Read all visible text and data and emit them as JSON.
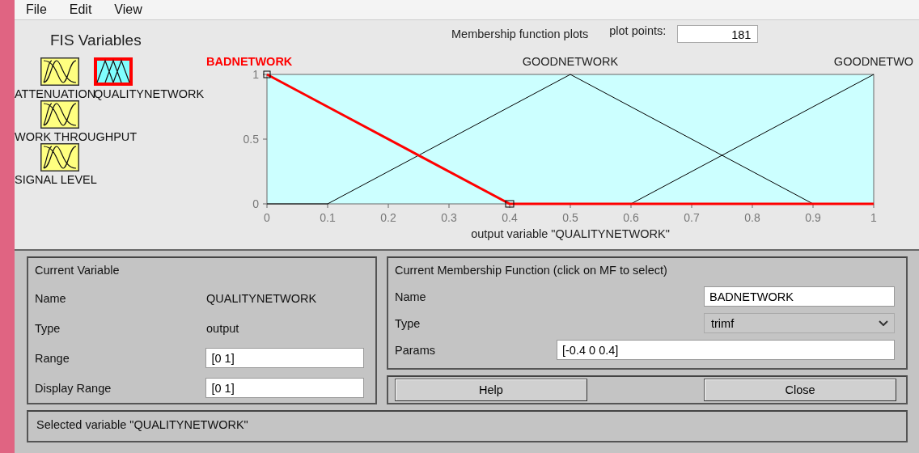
{
  "menu": [
    "File",
    "Edit",
    "View"
  ],
  "fis_variables": {
    "title": "FIS Variables",
    "variables": [
      {
        "name": "ATTENUATION",
        "selected": false
      },
      {
        "name": "QUALITYNETWORK",
        "selected": true
      },
      {
        "name": "WORK THROUGHPUT",
        "selected": false
      },
      {
        "name": "SIGNAL LEVEL",
        "selected": false
      }
    ]
  },
  "plot": {
    "title": "Membership function plots",
    "plot_points_label": "plot points:",
    "plot_points": "181",
    "chart_data": {
      "type": "line",
      "xlabel": "output variable \"QUALITYNETWORK\"",
      "x": [
        0,
        0.1,
        0.4,
        0.5,
        0.6,
        0.9,
        1
      ],
      "series": [
        {
          "name": "BADNETWORK",
          "color": "#ff0000",
          "values": [
            1,
            0.75,
            0,
            0,
            0,
            0,
            0
          ]
        },
        {
          "name": "GOODNETWORK",
          "color": "#000000",
          "values": [
            0,
            0,
            0.75,
            1,
            0.75,
            0,
            null
          ]
        },
        {
          "name": "GOODNETWO",
          "color": "#000000",
          "values": [
            null,
            null,
            null,
            null,
            0,
            0.75,
            1
          ]
        }
      ],
      "xlim": [
        0,
        1
      ],
      "ylim": [
        0,
        1
      ],
      "xticks": [
        0,
        0.1,
        0.2,
        0.3,
        0.4,
        0.5,
        0.6,
        0.7,
        0.8,
        0.9,
        1
      ],
      "yticks": [
        0,
        0.5,
        1
      ]
    }
  },
  "current_variable": {
    "title": "Current Variable",
    "fields": [
      {
        "label": "Name",
        "value": "QUALITYNETWORK",
        "kind": "text"
      },
      {
        "label": "Type",
        "value": "output",
        "kind": "text"
      },
      {
        "label": "Range",
        "value": "[0 1]",
        "kind": "input"
      },
      {
        "label": "Display Range",
        "value": "[0 1]",
        "kind": "input"
      }
    ]
  },
  "current_mf": {
    "title": "Current Membership Function (click on MF to select)",
    "fields": [
      {
        "label": "Name",
        "value": "BADNETWORK",
        "kind": "input"
      },
      {
        "label": "Type",
        "value": "trimf",
        "kind": "dropdown"
      },
      {
        "label": "Params",
        "value": "[-0.4 0 0.4]",
        "kind": "wide-input"
      }
    ]
  },
  "buttons": [
    "Help",
    "Close"
  ],
  "status": "Selected variable \"QUALITYNETWORK\""
}
